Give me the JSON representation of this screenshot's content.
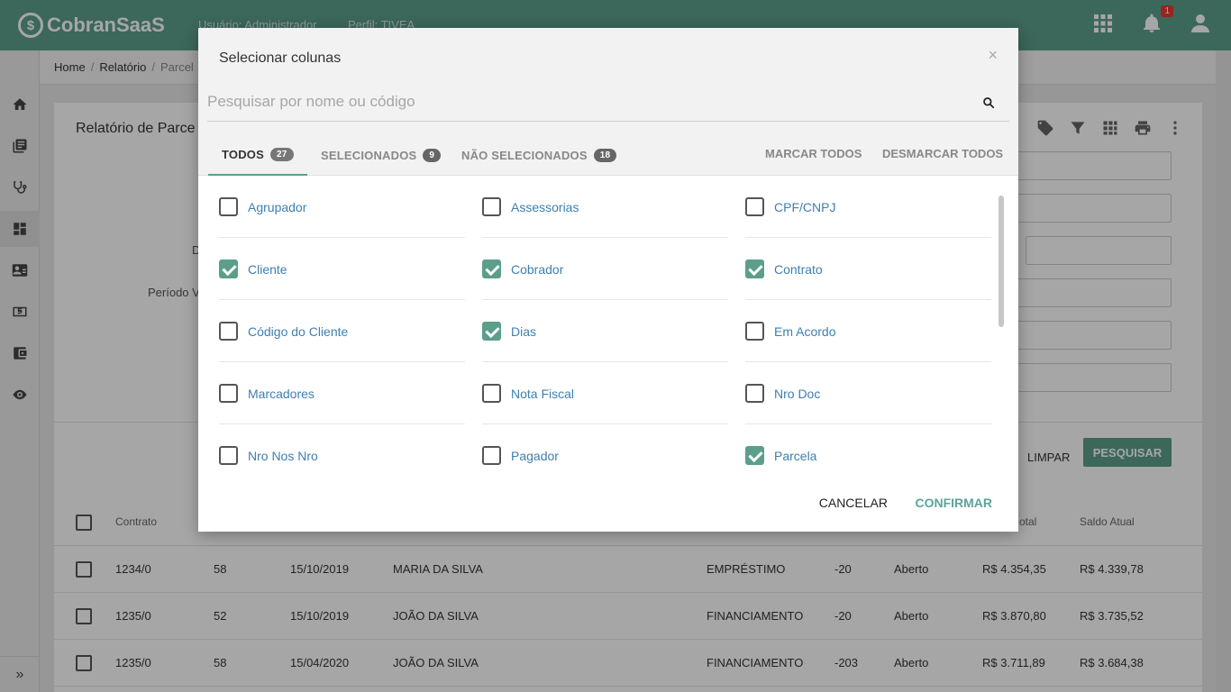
{
  "header": {
    "logo": "CobranSaaS",
    "user_label": "Usuário: Administrador",
    "profile_label": "Perfil: TIVEA",
    "notifications_count": "1"
  },
  "breadcrumb": {
    "home": "Home",
    "relatorio": "Relatório",
    "current": "Parcel"
  },
  "report": {
    "title": "Relatório de Parce",
    "label_d": "D",
    "label_periodo": "Período Ve",
    "limpar": "LIMPAR",
    "pesquisar": "PESQUISAR"
  },
  "table": {
    "headers": {
      "contrato": "Contrato",
      "total": "otal",
      "saldo": "Saldo Atual"
    },
    "rows": [
      {
        "contrato": "1234/0",
        "dias": "58",
        "vencimento": "15/10/2019",
        "cliente": "MARIA DA SILVA",
        "produto": "EMPRÉSTIMO",
        "d": "-20",
        "status": "Aberto",
        "total": "R$ 4.354,35",
        "saldo": "R$ 4.339,78"
      },
      {
        "contrato": "1235/0",
        "dias": "52",
        "vencimento": "15/10/2019",
        "cliente": "JOÃO DA SILVA",
        "produto": "FINANCIAMENTO",
        "d": "-20",
        "status": "Aberto",
        "total": "R$ 3.870,80",
        "saldo": "R$ 3.735,52"
      },
      {
        "contrato": "1235/0",
        "dias": "58",
        "vencimento": "15/04/2020",
        "cliente": "JOÃO DA SILVA",
        "produto": "FINANCIAMENTO",
        "d": "-203",
        "status": "Aberto",
        "total": "R$ 3.711,89",
        "saldo": "R$ 3.684,38"
      }
    ]
  },
  "modal": {
    "title": "Selecionar colunas",
    "close": "×",
    "search_placeholder": "Pesquisar por nome ou código",
    "tabs": [
      {
        "label": "TODOS",
        "count": "27"
      },
      {
        "label": "SELECIONADOS",
        "count": "9"
      },
      {
        "label": "NÃO SELECIONADOS",
        "count": "18"
      }
    ],
    "marcar_todos": "MARCAR TODOS",
    "desmarcar_todos": "DESMARCAR TODOS",
    "options": [
      {
        "label": "Agrupador",
        "checked": false
      },
      {
        "label": "Assessorias",
        "checked": false
      },
      {
        "label": "CPF/CNPJ",
        "checked": false
      },
      {
        "label": "Cliente",
        "checked": true
      },
      {
        "label": "Cobrador",
        "checked": true
      },
      {
        "label": "Contrato",
        "checked": true
      },
      {
        "label": "Código do Cliente",
        "checked": false
      },
      {
        "label": "Dias",
        "checked": true
      },
      {
        "label": "Em Acordo",
        "checked": false
      },
      {
        "label": "Marcadores",
        "checked": false
      },
      {
        "label": "Nota Fiscal",
        "checked": false
      },
      {
        "label": "Nro Doc",
        "checked": false
      },
      {
        "label": "Nro Nos Nro",
        "checked": false
      },
      {
        "label": "Pagador",
        "checked": false
      },
      {
        "label": "Parcela",
        "checked": true
      }
    ],
    "cancel": "CANCELAR",
    "confirm": "CONFIRMAR"
  },
  "colors": {
    "accent": "#5c9e8c",
    "link": "#3e7fb0"
  }
}
